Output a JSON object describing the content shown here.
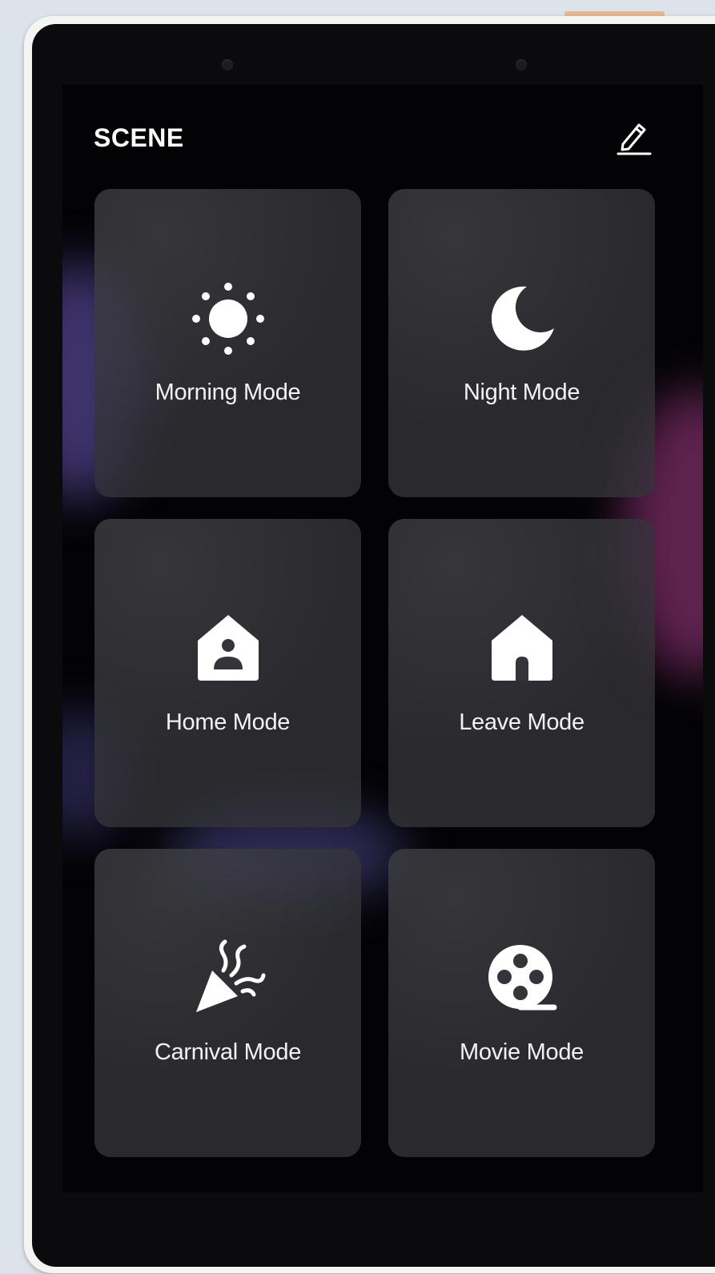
{
  "screen": {
    "title": "SCENE"
  },
  "icons": {
    "edit": "pencil-icon"
  },
  "scenes": [
    {
      "label": "Morning Mode",
      "icon": "sun-icon"
    },
    {
      "label": "Night Mode",
      "icon": "moon-icon"
    },
    {
      "label": "Home Mode",
      "icon": "home-person-icon"
    },
    {
      "label": "Leave Mode",
      "icon": "house-icon"
    },
    {
      "label": "Carnival Mode",
      "icon": "party-popper-icon"
    },
    {
      "label": "Movie Mode",
      "icon": "film-reel-icon"
    }
  ],
  "colors": {
    "screen_background": "#030305",
    "tile_background": "#34343a",
    "text": "#ffffff",
    "accent_purple": "#7a5aa8",
    "accent_magenta": "#a8407e"
  }
}
